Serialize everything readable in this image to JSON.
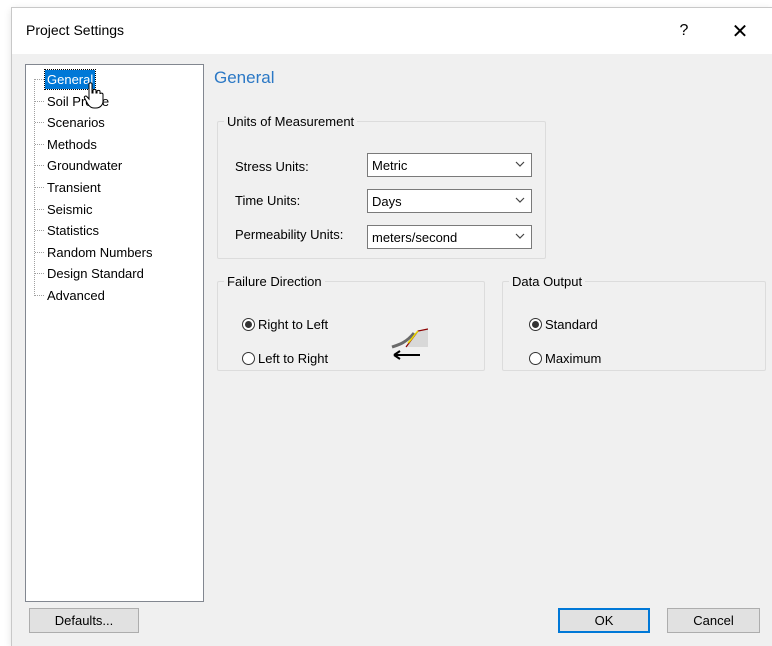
{
  "window": {
    "title": "Project Settings",
    "help_label": "?",
    "close_label": "✕"
  },
  "tree": {
    "items": [
      {
        "label": "General"
      },
      {
        "label": "Soil Profile"
      },
      {
        "label": "Scenarios"
      },
      {
        "label": "Methods"
      },
      {
        "label": "Groundwater"
      },
      {
        "label": "Transient"
      },
      {
        "label": "Seismic"
      },
      {
        "label": "Statistics"
      },
      {
        "label": "Random Numbers"
      },
      {
        "label": "Design Standard"
      },
      {
        "label": "Advanced"
      }
    ],
    "selected": "General"
  },
  "section": {
    "heading": "General"
  },
  "units": {
    "legend": "Units of Measurement",
    "stress_label": "Stress Units:",
    "stress_value": "Metric",
    "time_label": "Time Units:",
    "time_value": "Days",
    "permeability_label": "Permeability Units:",
    "permeability_value": "meters/second"
  },
  "failure": {
    "legend": "Failure Direction",
    "option_rtl": "Right to Left",
    "option_ltr": "Left to Right",
    "selected": "Right to Left"
  },
  "output": {
    "legend": "Data Output",
    "option_standard": "Standard",
    "option_maximum": "Maximum",
    "selected": "Standard"
  },
  "buttons": {
    "defaults": "Defaults...",
    "ok": "OK",
    "cancel": "Cancel"
  },
  "colors": {
    "accent": "#0078d7",
    "heading": "#2b78c5",
    "dialog_bg": "#f0f0f0"
  }
}
